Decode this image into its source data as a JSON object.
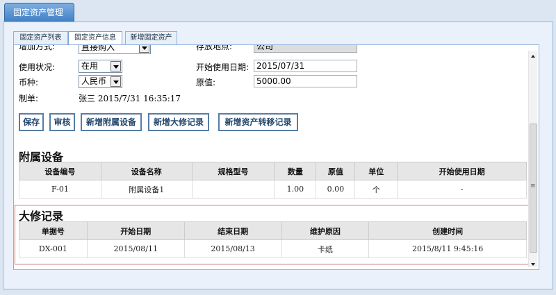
{
  "window_tab": "固定资产管理",
  "tabs": [
    {
      "label": "固定资产列表"
    },
    {
      "label": "固定资产信息"
    },
    {
      "label": "新增固定资产"
    }
  ],
  "form": {
    "add_method_label": "增加方式:",
    "add_method_value": "直接购入",
    "location_label": "存放地点:",
    "location_value": "公司",
    "usage_status_label": "使用状况:",
    "usage_status_value": "在用",
    "start_date_label": "开始使用日期:",
    "start_date_value": "2015/07/31",
    "currency_label": "币种:",
    "currency_value": "人民币",
    "original_value_label": "原值:",
    "original_value_value": "5000.00",
    "creator_label": "制单:",
    "creator_value": "张三 2015/7/31 16:35:17"
  },
  "buttons": {
    "save": "保存",
    "audit": "审核",
    "add_accessory": "新增附属设备",
    "add_overhaul": "新增大修记录",
    "add_transfer": "新增资产转移记录"
  },
  "accessory": {
    "title": "附属设备",
    "headers": [
      "设备编号",
      "设备名称",
      "规格型号",
      "数量",
      "原值",
      "单位",
      "开始使用日期"
    ],
    "rows": [
      [
        "F-01",
        "附属设备1",
        "",
        "1.00",
        "0.00",
        "个",
        "-"
      ]
    ]
  },
  "overhaul": {
    "title": "大修记录",
    "headers": [
      "单据号",
      "开始日期",
      "结束日期",
      "维护原因",
      "创建时间"
    ],
    "rows": [
      [
        "DX-001",
        "2015/08/11",
        "2015/08/13",
        "卡纸",
        "2015/8/11 9:45:16"
      ]
    ]
  }
}
